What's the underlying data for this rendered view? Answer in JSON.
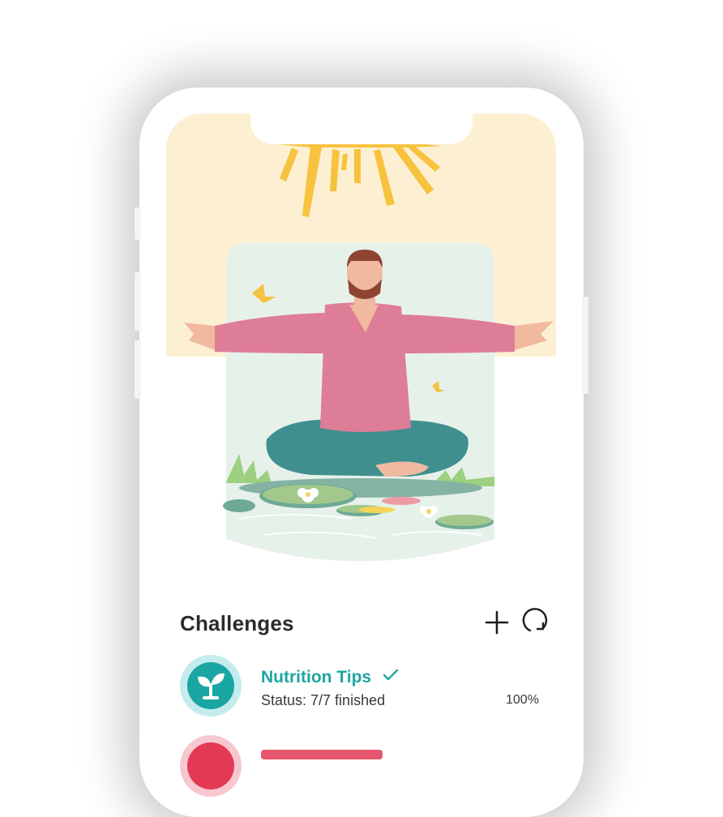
{
  "section": {
    "title": "Challenges",
    "add_icon": "plus-icon",
    "refresh_icon": "refresh-icon"
  },
  "challenges": [
    {
      "name": "Nutrition Tips",
      "status": "Status: 7/7 finished",
      "percent": "100%",
      "icon": "sprout-icon",
      "completed": true,
      "accent": "#1fa5a0"
    }
  ],
  "colors": {
    "hero_background": "#fdf0d2",
    "accent": "#1fa5a0",
    "second_accent": "#e23a55"
  }
}
